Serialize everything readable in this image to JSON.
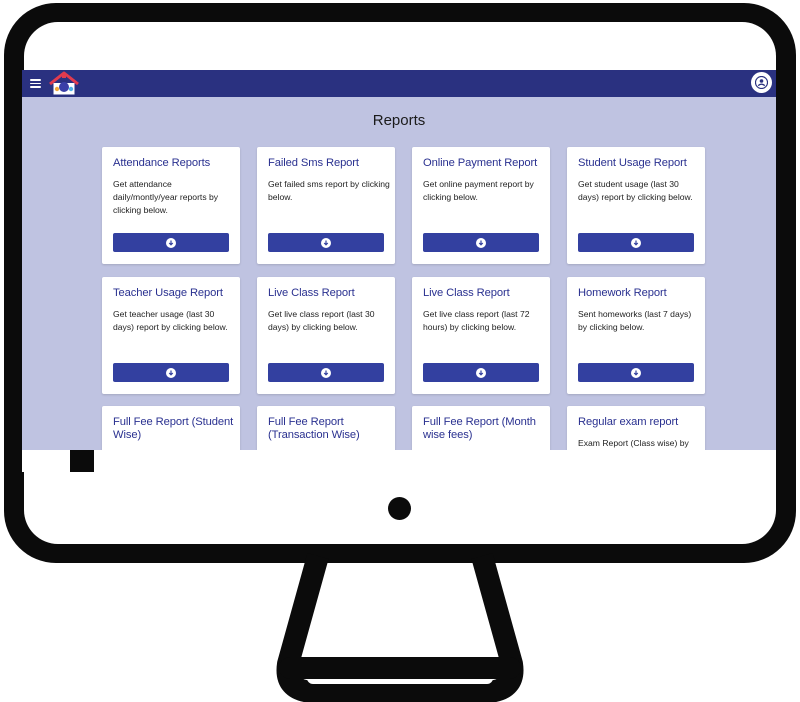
{
  "app": {
    "title": "Reports"
  },
  "header": {
    "menu_icon": "hamburger-menu-icon",
    "logo_icon": "school-house-logo",
    "profile_icon": "user-account-icon"
  },
  "colors": {
    "appbar": "#2a3180",
    "screen_bg": "#bfc3e1",
    "card_title": "#2a3190",
    "button": "#3340a0"
  },
  "reports": [
    {
      "title": "Attendance Reports",
      "description": "Get attendance daily/montly/year reports by clicking below.",
      "button_icon": "download-circle-icon"
    },
    {
      "title": "Failed Sms Report",
      "description": "Get failed sms report by clicking below.",
      "button_icon": "download-circle-icon"
    },
    {
      "title": "Online Payment Report",
      "description": "Get online payment report by clicking below.",
      "button_icon": "download-circle-icon"
    },
    {
      "title": "Student Usage Report",
      "description": "Get student usage (last 30 days) report by clicking below.",
      "button_icon": "download-circle-icon"
    },
    {
      "title": "Teacher Usage Report",
      "description": "Get teacher usage (last 30 days) report by clicking below.",
      "button_icon": "download-circle-icon"
    },
    {
      "title": "Live Class Report",
      "description": "Get live class report (last 30 days) by clicking below.",
      "button_icon": "download-circle-icon"
    },
    {
      "title": "Live Class Report",
      "description": "Get live class report (last 72 hours) by clicking below.",
      "button_icon": "download-circle-icon"
    },
    {
      "title": "Homework Report",
      "description": "Sent homeworks (last 7 days) by clicking below.",
      "button_icon": "download-circle-icon"
    },
    {
      "title": "Full Fee Report (Student Wise)",
      "description": "",
      "button_icon": "download-circle-icon"
    },
    {
      "title": "Full Fee Report (Transaction Wise)",
      "description": "",
      "button_icon": "download-circle-icon"
    },
    {
      "title": "Full Fee Report (Month wise fees)",
      "description": "",
      "button_icon": "download-circle-icon"
    },
    {
      "title": "Regular exam report",
      "description": "Exam Report (Class wise) by",
      "button_icon": "download-circle-icon"
    }
  ]
}
